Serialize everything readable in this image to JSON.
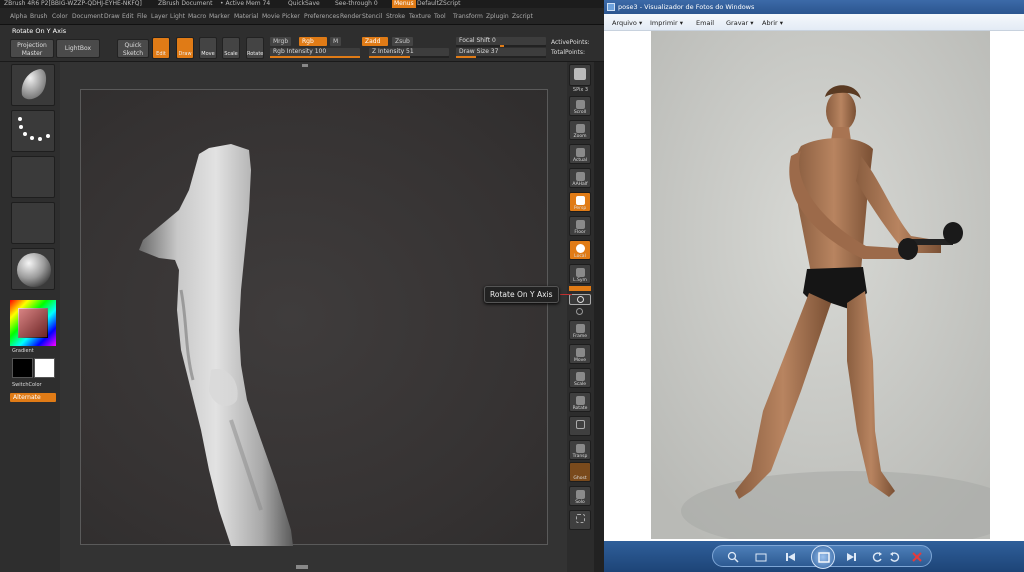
{
  "zbrush": {
    "title_items": [
      "ZBrush 4R6 P2[BBIG-WZZP-QDHJ-EYHE-NKFQ]",
      "ZBrush Document",
      "• Active Mem 74",
      "QuickSave",
      "See-through 0",
      "Menus",
      "DefaultZScript"
    ],
    "menu_items": [
      "Alpha",
      "Brush",
      "Color",
      "Document",
      "Draw",
      "Edit",
      "File",
      "Layer",
      "Light",
      "Macro",
      "Marker",
      "Material",
      "Movie",
      "Picker",
      "Preferences",
      "Render",
      "Stencil",
      "Stroke",
      "Texture",
      "Tool",
      "Transform",
      "Zplugin",
      "Zscript"
    ],
    "current_action": "Rotate On Y Axis",
    "toolbar": {
      "projection_master": "Projection Master",
      "lightbox": "LightBox",
      "quick_sketch": "Quick Sketch",
      "edit": "Edit",
      "draw": "Draw",
      "move": "Move",
      "scale": "Scale",
      "rotate": "Rotate",
      "mrgb": "Mrgb",
      "rgb": "Rgb",
      "m": "M",
      "zadd": "Zadd",
      "zsub": "Zsub",
      "rgb_intensity": "Rgb Intensity 100",
      "z_intensity": "Z Intensity 51",
      "focal_shift": "Focal Shift 0",
      "draw_size": "Draw Size 37",
      "active_points": "ActivePoints:",
      "total_points": "TotalPoints:"
    },
    "left_panel": {
      "gradient": "Gradient",
      "switch_color": "SwitchColor",
      "alternate": "Alternate"
    },
    "right_panel": [
      {
        "label": "SPix 3",
        "on": false
      },
      {
        "label": "Scroll",
        "on": false
      },
      {
        "label": "Zoom",
        "on": false
      },
      {
        "label": "Actual",
        "on": false
      },
      {
        "label": "AAHalf",
        "on": false
      },
      {
        "label": "Persp",
        "on": true
      },
      {
        "label": "Floor",
        "on": false
      },
      {
        "label": "Local",
        "on": true
      },
      {
        "label": "L.Sym",
        "on": false
      },
      {
        "label": "Frame",
        "on": false
      },
      {
        "label": "Move",
        "on": false
      },
      {
        "label": "Scale",
        "on": false
      },
      {
        "label": "Rotate",
        "on": false
      },
      {
        "label": "Transp",
        "on": false
      },
      {
        "label": "Ghost",
        "on": false
      },
      {
        "label": "Solo",
        "on": false
      }
    ],
    "tooltip": "Rotate On Y Axis"
  },
  "viewer": {
    "title": "pose3 - Visualizador de Fotos do Windows",
    "menu": [
      "Arquivo ▾",
      "Imprimir ▾",
      "Email",
      "Gravar ▾",
      "Abrir ▾"
    ],
    "colors": {
      "title_bar": "#2b558f",
      "bottom_bar": "#1d4477"
    }
  }
}
